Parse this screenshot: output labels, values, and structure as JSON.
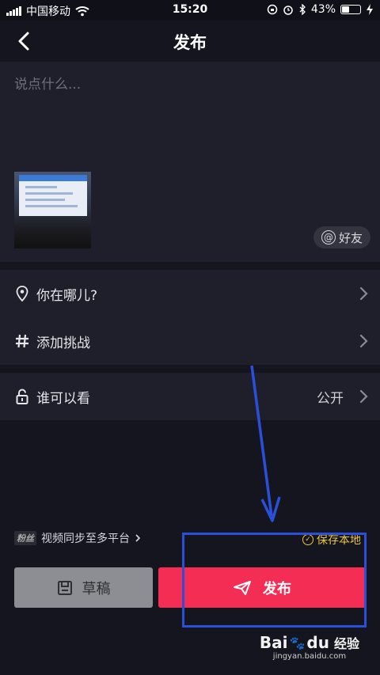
{
  "status_bar": {
    "carrier": "中国移动",
    "time": "15:20",
    "battery_percent": "43%",
    "battery_level": 0.43
  },
  "nav": {
    "title": "发布"
  },
  "compose": {
    "placeholder": "说点什么...",
    "mention_label": "好友"
  },
  "options": {
    "location": "你在哪儿?",
    "challenge": "添加挑战",
    "visibility": "谁可以看",
    "visibility_value": "公开"
  },
  "footer": {
    "sync_logo": "粉丝",
    "sync_label": "视频同步至多平台",
    "save_local": "保存本地",
    "draft_label": "草稿",
    "publish_label": "发布"
  },
  "watermark": {
    "brand_left": "Bai",
    "brand_right": "du",
    "suffix": "经验",
    "url": "jingyan.baidu.com"
  },
  "colors": {
    "background": "#15151f",
    "panel": "#1e1f2a",
    "publish": "#f42d55",
    "draft": "#8d8e93",
    "save_local": "#e8c645",
    "annotation": "#2a4fd9"
  }
}
